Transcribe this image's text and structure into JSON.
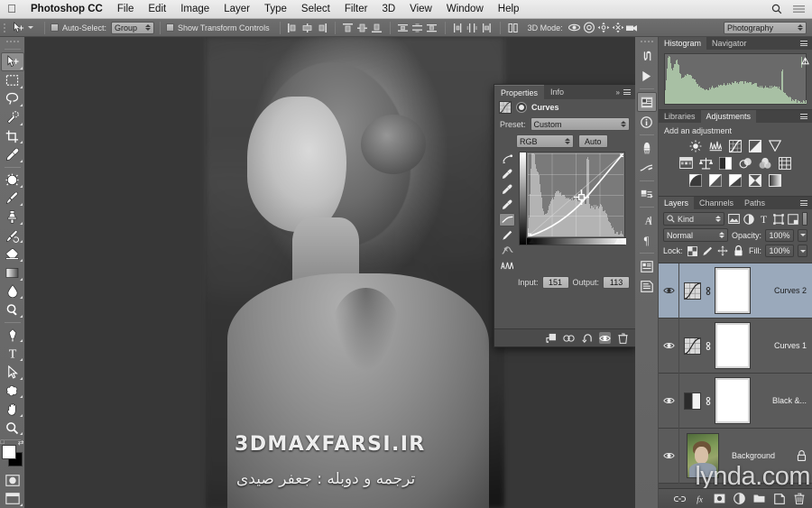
{
  "menubar": {
    "apple": "apple-logo",
    "items": [
      "Photoshop CC",
      "File",
      "Edit",
      "Image",
      "Layer",
      "Type",
      "Select",
      "Filter",
      "3D",
      "View",
      "Window",
      "Help"
    ],
    "right_icons": [
      "search-icon",
      "list-icon"
    ]
  },
  "options_bar": {
    "tool": "move-tool",
    "auto_select_label": "Auto-Select:",
    "auto_select_value": "Group",
    "show_transform_label": "Show Transform Controls",
    "three_d_label": "3D Mode:",
    "workspace": "Photography"
  },
  "toolbar": {
    "tools": [
      {
        "name": "move-tool",
        "active": true
      },
      {
        "name": "rectangular-marquee-tool",
        "active": false
      },
      {
        "name": "lasso-tool",
        "active": false
      },
      {
        "name": "quick-selection-tool",
        "active": false
      },
      {
        "name": "crop-tool",
        "active": false
      },
      {
        "name": "eyedropper-tool",
        "active": false
      },
      {
        "name": "spot-healing-brush-tool",
        "active": false
      },
      {
        "name": "brush-tool",
        "active": false
      },
      {
        "name": "clone-stamp-tool",
        "active": false
      },
      {
        "name": "history-brush-tool",
        "active": false
      },
      {
        "name": "eraser-tool",
        "active": false
      },
      {
        "name": "gradient-tool",
        "active": false
      },
      {
        "name": "blur-tool",
        "active": false
      },
      {
        "name": "dodge-tool",
        "active": false
      },
      {
        "name": "pen-tool",
        "active": false
      },
      {
        "name": "type-tool",
        "active": false
      },
      {
        "name": "path-selection-tool",
        "active": false
      },
      {
        "name": "custom-shape-tool",
        "active": false
      },
      {
        "name": "hand-tool",
        "active": false
      },
      {
        "name": "zoom-tool",
        "active": false
      }
    ],
    "foreground_color": "#ffffff",
    "background_color": "#000000"
  },
  "canvas": {
    "watermark_latin": "3DMAXFARSI.IR",
    "watermark_farsi": "ترجمه و دوبله : جعفر صیدی"
  },
  "properties_panel": {
    "tabs": [
      {
        "label": "Properties",
        "active": true
      },
      {
        "label": "Info",
        "active": false
      }
    ],
    "title": "Curves",
    "preset_label": "Preset:",
    "preset_value": "Custom",
    "channel_value": "RGB",
    "auto_button": "Auto",
    "input_label": "Input:",
    "input_value": "151",
    "output_label": "Output:",
    "output_value": "113",
    "footer_icons": [
      "clip-to-layer-icon",
      "view-previous-state-icon",
      "reset-icon",
      "toggle-visibility-icon",
      "delete-icon"
    ]
  },
  "dock_strip": {
    "icons": [
      "history-icon",
      "actions-icon",
      "properties-icon",
      "info-icon",
      "brush-icon",
      "brush-settings-icon",
      "clone-source-icon",
      "character-icon",
      "paragraph-icon",
      "character-styles-icon",
      "paragraph-styles-icon"
    ],
    "active": "properties-icon"
  },
  "histogram_panel": {
    "tabs": [
      {
        "label": "Histogram",
        "active": true
      },
      {
        "label": "Navigator",
        "active": false
      }
    ],
    "warning_icon": "uncached-data-warning-icon",
    "color": "#a8c0a4"
  },
  "adjustments_panel": {
    "tabs": [
      {
        "label": "Libraries",
        "active": false
      },
      {
        "label": "Adjustments",
        "active": true
      }
    ],
    "title": "Add an adjustment",
    "rows": [
      [
        "brightness-contrast-icon",
        "levels-icon",
        "curves-icon",
        "exposure-icon",
        "vibrance-icon"
      ],
      [
        "hue-saturation-icon",
        "color-balance-icon",
        "black-and-white-icon",
        "photo-filter-icon",
        "channel-mixer-icon",
        "color-lookup-icon"
      ],
      [
        "invert-icon",
        "posterize-icon",
        "threshold-icon",
        "selective-color-icon",
        "gradient-map-icon"
      ]
    ]
  },
  "layers_panel": {
    "tabs": [
      {
        "label": "Layers",
        "active": true
      },
      {
        "label": "Channels",
        "active": false
      },
      {
        "label": "Paths",
        "active": false
      }
    ],
    "kind_filter": "Kind",
    "filter_icons": [
      "pixel-filter-icon",
      "adjustment-filter-icon",
      "type-filter-icon",
      "shape-filter-icon",
      "smartobject-filter-icon"
    ],
    "blend_mode": "Normal",
    "opacity_label": "Opacity:",
    "opacity_value": "100%",
    "lock_label": "Lock:",
    "lock_icons": [
      "lock-transparent-pixels-icon",
      "lock-image-pixels-icon",
      "lock-position-icon",
      "lock-all-icon"
    ],
    "fill_label": "Fill:",
    "fill_value": "100%",
    "layers": [
      {
        "name": "Curves 2",
        "type": "curves-adjustment",
        "selected": true,
        "visible": true,
        "linked": true,
        "locked": false
      },
      {
        "name": "Curves 1",
        "type": "curves-adjustment",
        "selected": false,
        "visible": true,
        "linked": true,
        "locked": false
      },
      {
        "name": "Black &...",
        "type": "black-and-white-adjustment",
        "selected": false,
        "visible": true,
        "linked": true,
        "locked": false
      },
      {
        "name": "Background",
        "type": "image",
        "selected": false,
        "visible": true,
        "linked": false,
        "locked": true
      }
    ],
    "footer_icons": [
      "link-layers-icon",
      "layer-style-icon",
      "layer-mask-icon",
      "new-adjustment-layer-icon",
      "new-group-icon",
      "new-layer-icon",
      "delete-layer-icon"
    ]
  },
  "watermark": {
    "brand": "lynda.com"
  },
  "chart_data": {
    "type": "line",
    "title": "Curves",
    "xlabel": "Input",
    "ylabel": "Output",
    "xlim": [
      0,
      255
    ],
    "ylim": [
      0,
      255
    ],
    "grid": true,
    "points": [
      {
        "input": 0,
        "output": 0
      },
      {
        "input": 151,
        "output": 113
      },
      {
        "input": 255,
        "output": 255
      }
    ],
    "selected_point": {
      "input": 151,
      "output": 113
    },
    "histogram_note": "image histogram shown behind curve"
  }
}
